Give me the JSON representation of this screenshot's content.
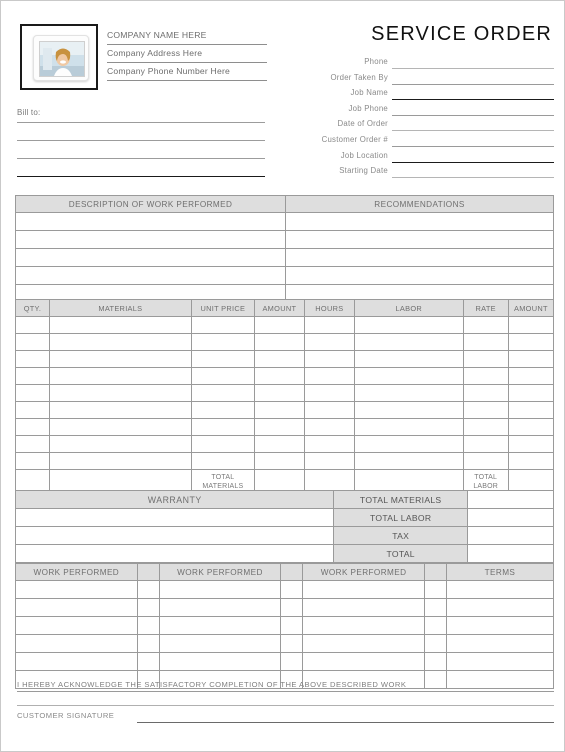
{
  "document": {
    "title": "SERVICE ORDER"
  },
  "company": {
    "name_line": "COMPANY NAME HERE",
    "address_line": "Company Address Here",
    "phone_line": "Company Phone Number Here",
    "logo_icon": "photo-placeholder-icon"
  },
  "bill_to": {
    "label": "Bill to:"
  },
  "order_fields": [
    {
      "label": "Phone",
      "value": ""
    },
    {
      "label": "Order Taken By",
      "value": ""
    },
    {
      "label": "Job Name",
      "value": ""
    },
    {
      "label": "Job Phone",
      "value": ""
    },
    {
      "label": "Date of Order",
      "value": ""
    },
    {
      "label": "Customer Order #",
      "value": ""
    },
    {
      "label": "Job Location",
      "value": ""
    },
    {
      "label": "Starting Date",
      "value": ""
    }
  ],
  "description_table": {
    "headers": [
      "DESCRIPTION OF WORK PERFORMED",
      "RECOMMENDATIONS"
    ],
    "row_count": 5
  },
  "materials_table": {
    "headers": [
      "QTY.",
      "MATERIALS",
      "UNIT PRICE",
      "AMOUNT",
      "HOURS",
      "LABOR",
      "RATE",
      "AMOUNT"
    ],
    "row_count": 9,
    "total_materials_label": "TOTAL MATERIALS",
    "total_labor_label": "TOTAL LABOR"
  },
  "warranty_table": {
    "warranty_header": "WARRANTY",
    "totals": [
      {
        "label": "TOTAL MATERIALS",
        "value": ""
      },
      {
        "label": "TOTAL LABOR",
        "value": ""
      },
      {
        "label": "TAX",
        "value": ""
      },
      {
        "label": "TOTAL",
        "value": ""
      }
    ]
  },
  "work_table": {
    "headers": [
      "WORK PERFORMED",
      "",
      "WORK PERFORMED",
      "",
      "WORK PERFORMED",
      "",
      "TERMS"
    ],
    "row_count": 6
  },
  "footer": {
    "acknowledgement": "I HEREBY ACKNOWLEDGE THE SATISFACTORY COMPLETION OF THE ABOVE DESCRIBED WORK",
    "signature_label": "CUSTOMER SIGNATURE"
  },
  "colors": {
    "header_gray": "#dedede",
    "border_gray": "#9a9a9a",
    "text_gray": "#7a7a7a",
    "dark": "#1a1a1a"
  }
}
